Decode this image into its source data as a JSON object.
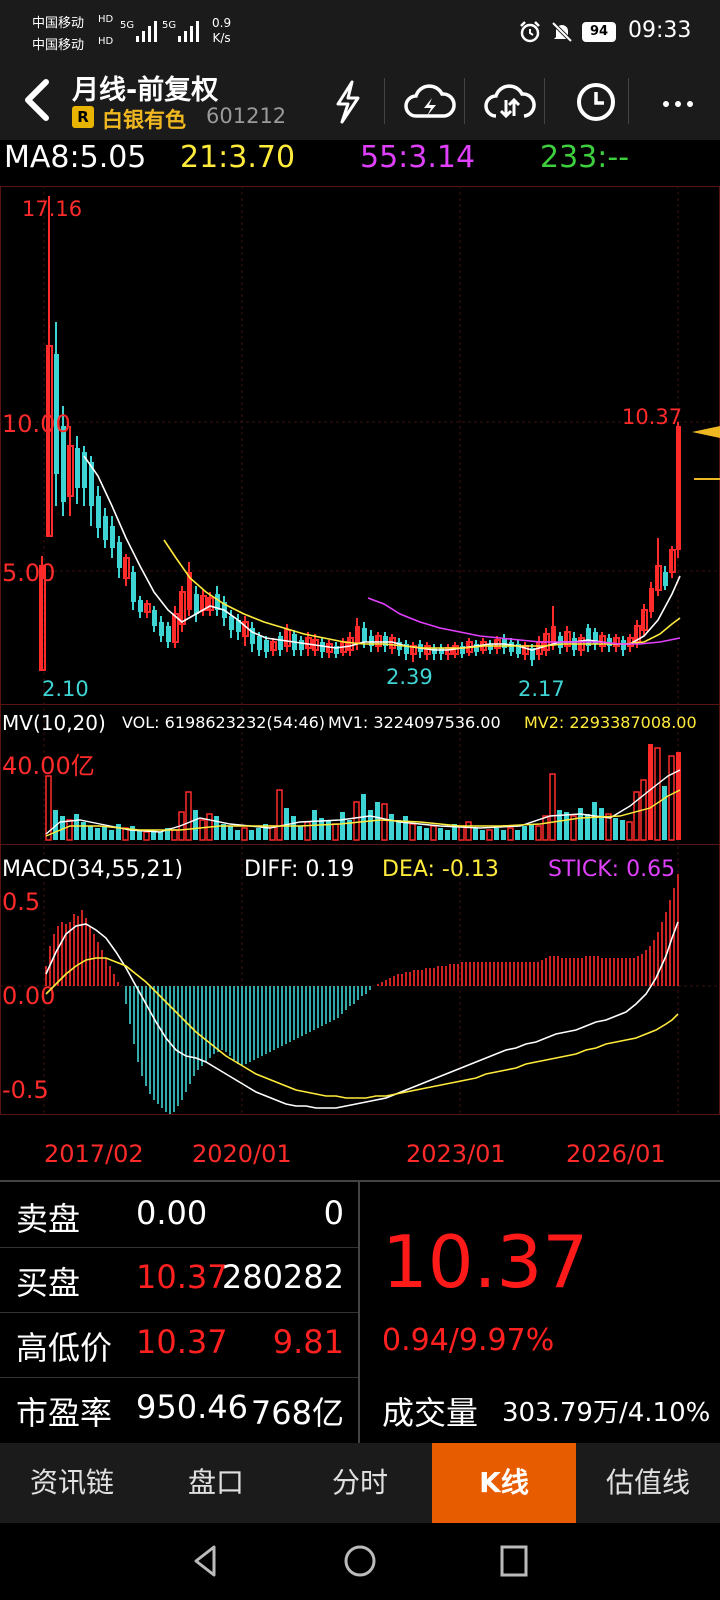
{
  "status": {
    "carrier1": "中国移动",
    "carrier2": "中国移动",
    "hd": "HD",
    "net": "5G",
    "speed_value": "0.9",
    "speed_unit": "K/s",
    "battery": "94",
    "time": "09:33"
  },
  "header": {
    "title": "月线-前复权",
    "badge": "R",
    "stock_name": "白银有色",
    "stock_code": "601212",
    "icons": [
      "back-icon",
      "flash-icon",
      "cloud-upload-icon",
      "cloud-sync-icon",
      "clock-icon",
      "more-icon"
    ]
  },
  "ma": {
    "ma8": "MA8:5.05",
    "ma21": "21:3.70",
    "ma55": "55:3.14",
    "ma233": "233:--"
  },
  "chart_labels": {
    "price_high": "17.16",
    "price_10": "10.00",
    "price_5": "5.00",
    "low_1": "2.10",
    "low_2": "2.39",
    "low_3": "2.17",
    "last_price": "10.37",
    "mv_title": "MV(10,20)",
    "vol": "VOL: 6198623232(54:46)",
    "mv1": "MV1: 3224097536.00",
    "mv2": "MV2: 2293387008.00",
    "vol_scale": "40.00亿",
    "macd_title": "MACD(34,55,21)",
    "diff": "DIFF: 0.19",
    "dea": "DEA: -0.13",
    "stick": "STICK: 0.65",
    "macd_top": "0.5",
    "macd_zero": "0.00",
    "macd_bottom": "-0.5",
    "dates": [
      "2017/02",
      "2020/01",
      "2023/01",
      "2026/01"
    ]
  },
  "colors": {
    "up": "#ff2b2b",
    "down": "#3fd4d4",
    "ma8": "#ffffff",
    "ma21": "#ffeb3b",
    "ma55": "#e040fb",
    "ma233": "#3ecf3e",
    "tab_active": "#e85c00"
  },
  "quote": {
    "sell_label": "卖盘",
    "sell_price": "0.00",
    "sell_vol": "0",
    "buy_label": "买盘",
    "buy_price": "10.37",
    "buy_vol": "280282",
    "hl_label": "高低价",
    "high": "10.37",
    "low": "9.81",
    "pe_label": "市盈率",
    "pe": "950.46",
    "mcap": "768亿",
    "price": "10.37",
    "change": "0.94/9.97%",
    "volume_label": "成交量",
    "volume": "303.79万/4.10%"
  },
  "tabs": [
    {
      "label": "资讯链",
      "active": false
    },
    {
      "label": "盘口",
      "active": false
    },
    {
      "label": "分时",
      "active": false
    },
    {
      "label": "K线",
      "active": true
    },
    {
      "label": "估值线",
      "active": false
    }
  ],
  "nav": [
    "back-triangle-icon",
    "home-circle-icon",
    "recents-square-icon"
  ]
}
